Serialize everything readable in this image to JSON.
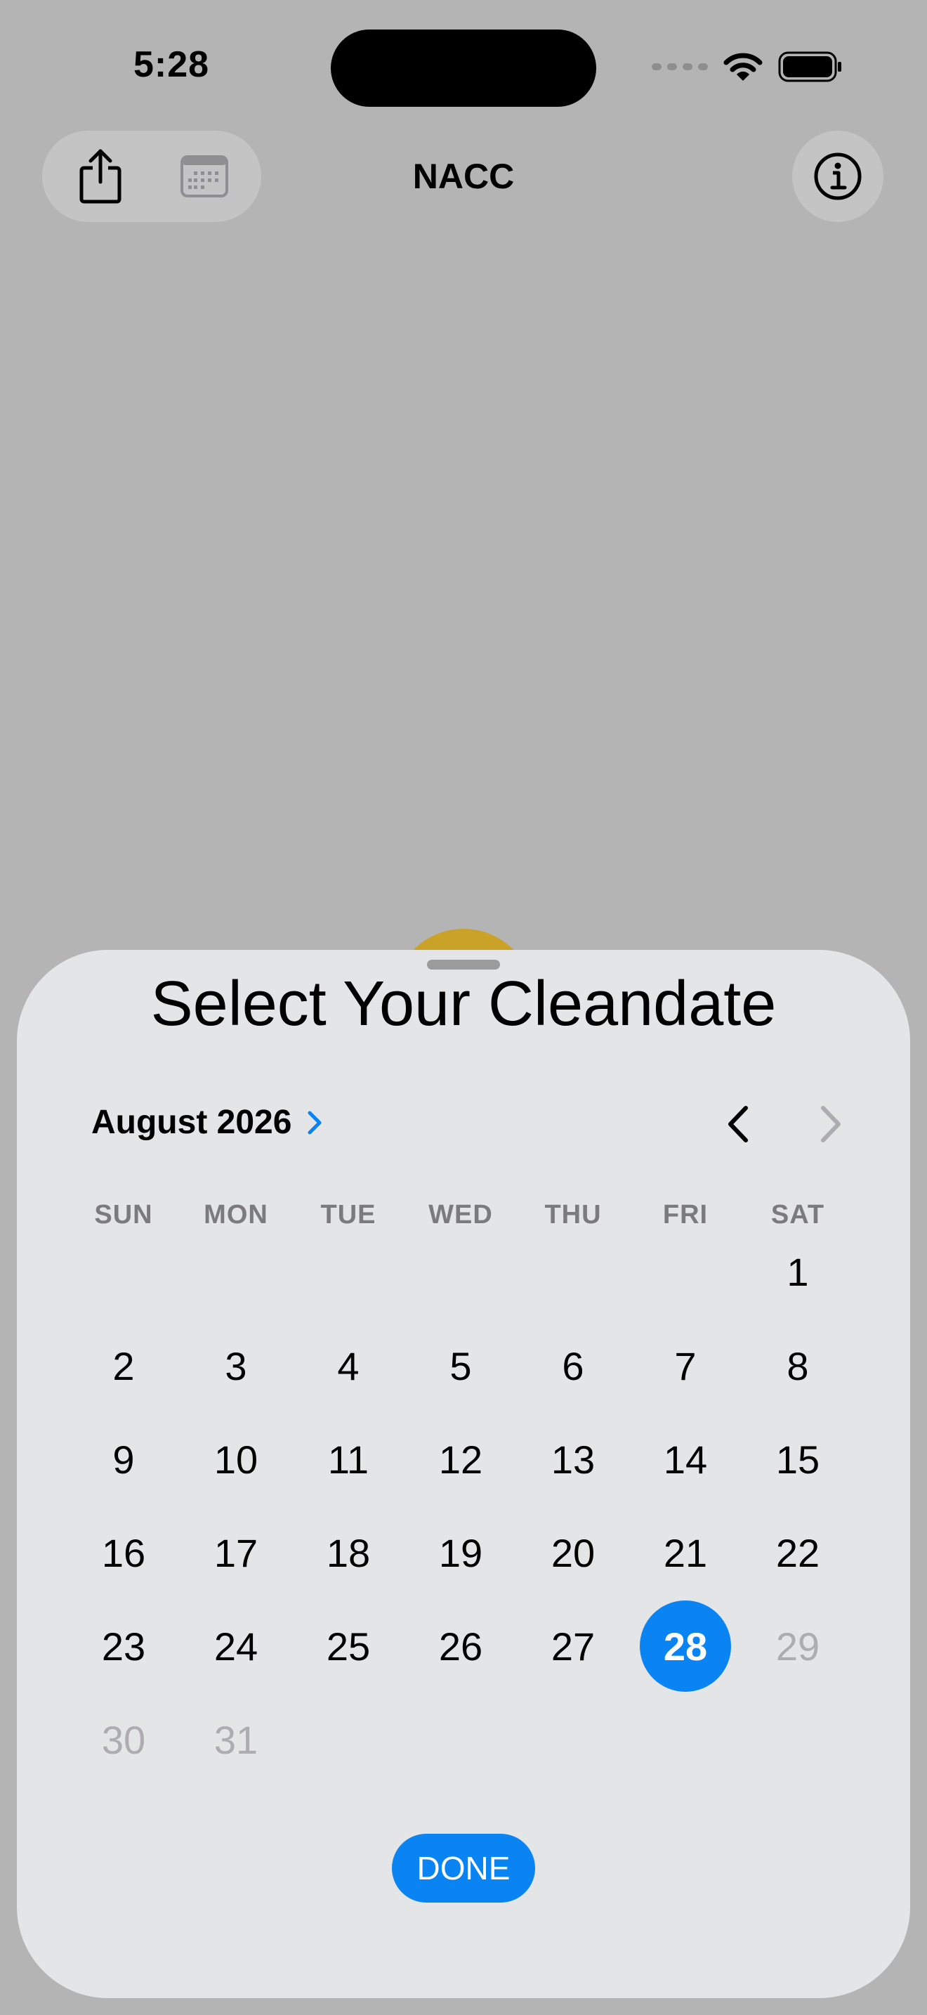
{
  "status_bar": {
    "time": "5:28",
    "icons": [
      "cellular-signal-icon",
      "wifi-icon",
      "battery-icon"
    ]
  },
  "nav_bar": {
    "title": "NACC",
    "left_buttons": [
      "share-icon",
      "calendar-icon"
    ],
    "right_button": "info-icon"
  },
  "sheet": {
    "title": "Select Your Cleandate",
    "month_label": "August 2026",
    "prev_month_icon": "chevron-left-icon",
    "next_month_icon": "chevron-right-icon",
    "weekdays": [
      "SUN",
      "MON",
      "TUE",
      "WED",
      "THU",
      "FRI",
      "SAT"
    ],
    "weeks": [
      [
        "",
        "",
        "",
        "",
        "",
        "",
        "1"
      ],
      [
        "2",
        "3",
        "4",
        "5",
        "6",
        "7",
        "8"
      ],
      [
        "9",
        "10",
        "11",
        "12",
        "13",
        "14",
        "15"
      ],
      [
        "16",
        "17",
        "18",
        "19",
        "20",
        "21",
        "22"
      ],
      [
        "23",
        "24",
        "25",
        "26",
        "27",
        "28",
        "29"
      ],
      [
        "30",
        "31",
        "",
        "",
        "",
        "",
        ""
      ]
    ],
    "selected_day": "28",
    "disabled_days": [
      "29",
      "30",
      "31"
    ],
    "done_label": "DONE"
  },
  "colors": {
    "accent": "#0A84F2",
    "backdrop": "#B4B4B4",
    "sheet_background": "#E4E5E7",
    "muted_text": "#ADADB1"
  }
}
